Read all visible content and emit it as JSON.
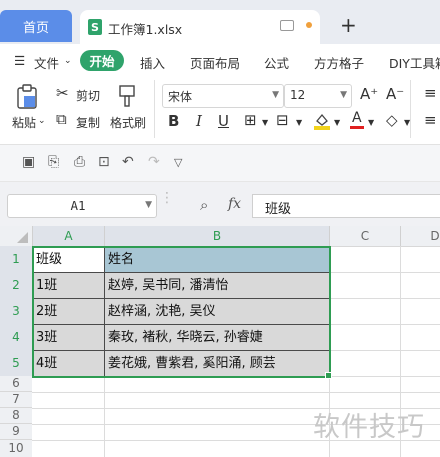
{
  "tabs": {
    "home": "首页",
    "file": "工作簿1.xlsx",
    "new_tab": "+"
  },
  "menu": {
    "file": "文件",
    "start": "开始",
    "items": [
      "插入",
      "页面布局",
      "公式",
      "方方格子",
      "DIY工具箱"
    ]
  },
  "ribbon": {
    "paste": "粘贴",
    "cut": "剪切",
    "copy": "复制",
    "format_painter": "格式刷",
    "font_name": "宋体",
    "font_size": "12",
    "bold": "B",
    "italic": "I",
    "underline": "U",
    "font_grow": "A⁺",
    "font_shrink": "A⁻",
    "font_color": "A"
  },
  "formula_bar": {
    "cell_ref": "A1",
    "fx": "fx",
    "content": "班级"
  },
  "grid": {
    "columns": [
      "A",
      "B",
      "C",
      "D"
    ],
    "rows": [
      "1",
      "2",
      "3",
      "4",
      "5",
      "6",
      "7",
      "8",
      "9",
      "10"
    ],
    "cells": [
      [
        "班级",
        "姓名"
      ],
      [
        "1班",
        "赵婷, 吴书同, 潘清怡"
      ],
      [
        "2班",
        "赵梓涵, 沈艳, 吴仪"
      ],
      [
        "3班",
        "秦玫, 褚秋, 华晓云, 孙睿婕"
      ],
      [
        "4班",
        "姜花娥, 曹紫君, 奚阳涌, 顾芸"
      ]
    ]
  },
  "watermark": "软件技巧",
  "colors": {
    "accent_green": "#2fa36b",
    "home_tab_blue": "#5b8de8",
    "header_fill": "#a8c6d4",
    "selection": "#2e9c52"
  }
}
